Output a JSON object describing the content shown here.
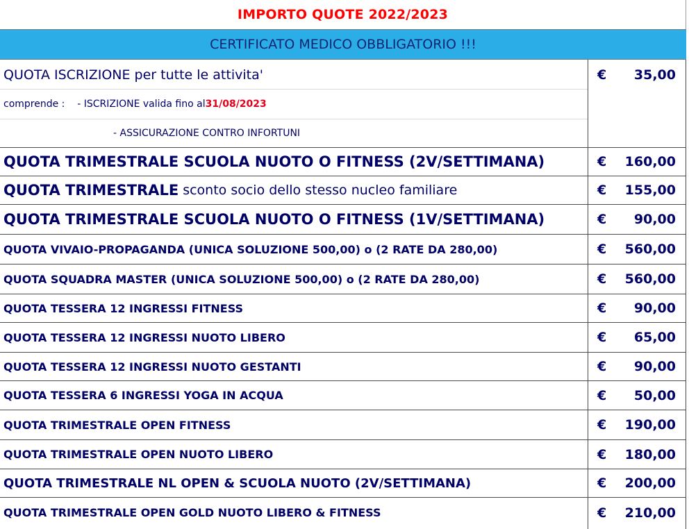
{
  "title": "IMPORTO QUOTE 2022/2023",
  "banner": "CERTIFICATO MEDICO OBBLIGATORIO !!!",
  "iscrizione": {
    "label": "QUOTA  ISCRIZIONE per tutte le attivita'",
    "currency": "€",
    "amount": "35,00",
    "comprende_prefix": "comprende :",
    "comprende_item1": "- ISCRIZIONE  valida fino al ",
    "comprende_date": "31/08/2023",
    "comprende_item2": "- ASSICURAZIONE CONTRO INFORTUNI"
  },
  "rows": [
    {
      "label": "QUOTA TRIMESTRALE SCUOLA NUOTO O FITNESS (2V/SETTIMANA)",
      "currency": "€",
      "amount": "160,00"
    },
    {
      "label_bold": "QUOTA TRIMESTRALE",
      "label_rest": " sconto socio dello stesso nucleo familiare",
      "currency": "€",
      "amount": "155,00"
    },
    {
      "label": "QUOTA TRIMESTRALE SCUOLA NUOTO O FITNESS (1V/SETTIMANA)",
      "currency": "€",
      "amount": "90,00"
    },
    {
      "label": "QUOTA VIVAIO-PROPAGANDA (UNICA SOLUZIONE 500,00) o (2 RATE DA 280,00)",
      "currency": "€",
      "amount": "560,00"
    },
    {
      "label": "QUOTA SQUADRA MASTER (UNICA SOLUZIONE 500,00) o (2 RATE DA 280,00)",
      "currency": "€",
      "amount": "560,00"
    },
    {
      "label": "QUOTA TESSERA 12 INGRESSI FITNESS",
      "currency": "€",
      "amount": "90,00"
    },
    {
      "label": "QUOTA TESSERA 12 INGRESSI NUOTO LIBERO",
      "currency": "€",
      "amount": "65,00"
    },
    {
      "label": "QUOTA TESSERA 12 INGRESSI NUOTO GESTANTI",
      "currency": "€",
      "amount": "90,00"
    },
    {
      "label": "QUOTA TESSERA 6 INGRESSI YOGA IN ACQUA",
      "currency": "€",
      "amount": "50,00"
    },
    {
      "label": "QUOTA TRIMESTRALE OPEN FITNESS",
      "currency": "€",
      "amount": "190,00"
    },
    {
      "label": "QUOTA TRIMESTRALE OPEN NUOTO LIBERO",
      "currency": "€",
      "amount": "180,00"
    },
    {
      "label": "QUOTA TRIMESTRALE NL OPEN & SCUOLA NUOTO (2V/SETTIMANA)",
      "currency": "€",
      "amount": "200,00"
    },
    {
      "label": "QUOTA TRIMESTRALE OPEN GOLD NUOTO LIBERO & FITNESS",
      "currency": "€",
      "amount": "210,00"
    }
  ]
}
